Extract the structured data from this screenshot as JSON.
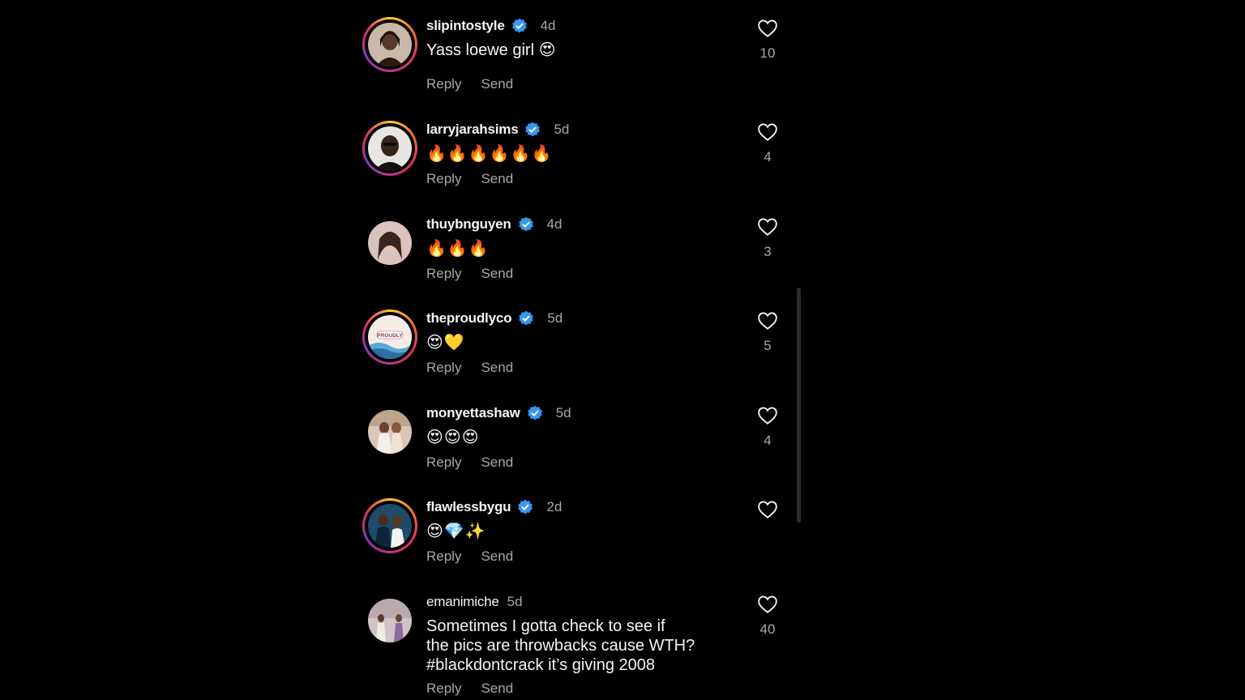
{
  "actions": {
    "reply": "Reply",
    "send": "Send"
  },
  "colors": {
    "background": "#000000",
    "verified": "#3897f0",
    "secondary_text": "#a8a8a8"
  },
  "comments": [
    {
      "username": "slipintostyle",
      "verified": true,
      "time": "4d",
      "text": "Yass loewe girl 😍",
      "likes": "10",
      "story_ring": true,
      "avatar": "woman-portrait"
    },
    {
      "username": "larryjarahsims",
      "verified": true,
      "time": "5d",
      "text": "🔥🔥🔥🔥🔥🔥",
      "likes": "4",
      "story_ring": true,
      "avatar": "man-portrait"
    },
    {
      "username": "thuybnguyen",
      "verified": true,
      "time": "4d",
      "text": "🔥🔥🔥",
      "likes": "3",
      "story_ring": false,
      "avatar": "woman-portrait"
    },
    {
      "username": "theproudlyco",
      "verified": true,
      "time": "5d",
      "text": "😍💛",
      "likes": "5",
      "story_ring": true,
      "avatar": "brand-logo",
      "avatar_text": "PROUDLY"
    },
    {
      "username": "monyettashaw",
      "verified": true,
      "time": "5d",
      "text": "😍😍😍",
      "likes": "4",
      "story_ring": false,
      "avatar": "couple-photo"
    },
    {
      "username": "flawlessbygu",
      "verified": true,
      "time": "2d",
      "text": "😍💎✨",
      "likes": "",
      "story_ring": true,
      "avatar": "couple-photo"
    },
    {
      "username": "emanimiche",
      "verified": false,
      "time": "5d",
      "text": "Sometimes I gotta check to see if\nthe pics are throwbacks cause WTH?\n#blackdontcrack it’s giving 2008",
      "likes": "40",
      "story_ring": false,
      "avatar": "group-photo"
    }
  ]
}
